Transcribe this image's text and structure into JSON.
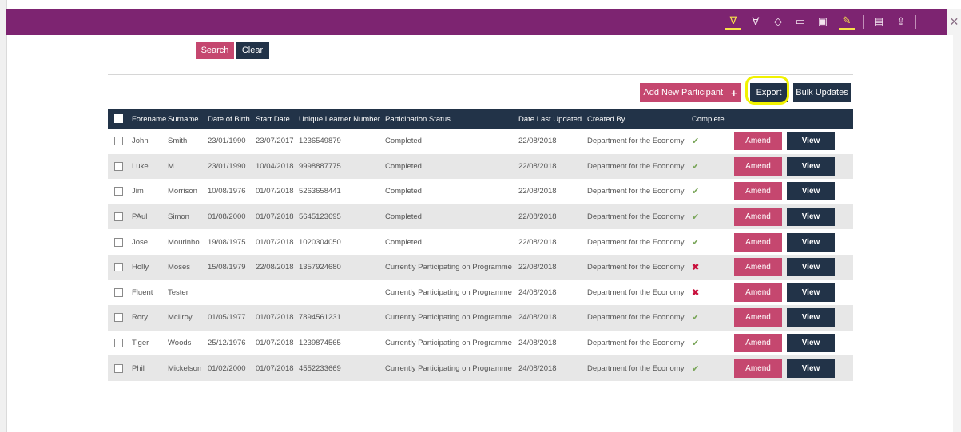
{
  "toolbar": {
    "tools": [
      {
        "icon": "pen-icon",
        "glyph": "∇"
      },
      {
        "icon": "highlighter-icon",
        "glyph": "∀"
      },
      {
        "icon": "eraser-icon",
        "glyph": "◇"
      },
      {
        "icon": "comment-icon",
        "glyph": "▭"
      },
      {
        "icon": "clip-icon",
        "glyph": "▣"
      },
      {
        "icon": "touch-write-icon",
        "glyph": "✎"
      },
      {
        "icon": "save-icon",
        "glyph": "▤"
      },
      {
        "icon": "share-icon",
        "glyph": "⇪"
      }
    ],
    "close_glyph": "✕"
  },
  "search": {
    "search_label": "Search",
    "clear_label": "Clear"
  },
  "actions": {
    "add_label": "Add New Participant",
    "add_glyph": "+",
    "export_label": "Export",
    "bulk_label": "Bulk Updates"
  },
  "table": {
    "headers": [
      "Forename",
      "Surname",
      "Date of Birth",
      "Start Date",
      "Unique Learner Number",
      "Participation Status",
      "Date Last Updated",
      "Created By",
      "Complete"
    ],
    "amend_label": "Amend",
    "view_label": "View",
    "rows": [
      {
        "forename": "John",
        "surname": "Smith",
        "dob": "23/01/1990",
        "start": "23/07/2017",
        "uln": "1236549879",
        "status": "Completed",
        "updated": "22/08/2018",
        "created_by": "Department for the Economy",
        "complete": "✔",
        "complete_state": "yes"
      },
      {
        "forename": "Luke",
        "surname": "M",
        "dob": "23/01/1990",
        "start": "10/04/2018",
        "uln": "9998887775",
        "status": "Completed",
        "updated": "22/08/2018",
        "created_by": "Department for the Economy",
        "complete": "✔",
        "complete_state": "yes"
      },
      {
        "forename": "Jim",
        "surname": "Morrison",
        "dob": "10/08/1976",
        "start": "01/07/2018",
        "uln": "5263658441",
        "status": "Completed",
        "updated": "22/08/2018",
        "created_by": "Department for the Economy",
        "complete": "✔",
        "complete_state": "yes"
      },
      {
        "forename": "PAul",
        "surname": "Simon",
        "dob": "01/08/2000",
        "start": "01/07/2018",
        "uln": "5645123695",
        "status": "Completed",
        "updated": "22/08/2018",
        "created_by": "Department for the Economy",
        "complete": "✔",
        "complete_state": "yes"
      },
      {
        "forename": "Jose",
        "surname": "Mourinho",
        "dob": "19/08/1975",
        "start": "01/07/2018",
        "uln": "1020304050",
        "status": "Completed",
        "updated": "22/08/2018",
        "created_by": "Department for the Economy",
        "complete": "✔",
        "complete_state": "yes"
      },
      {
        "forename": "Holly",
        "surname": "Moses",
        "dob": "15/08/1979",
        "start": "22/08/2018",
        "uln": "1357924680",
        "status": "Currently Participating on Programme",
        "updated": "22/08/2018",
        "created_by": "Department for the Economy",
        "complete": "✖",
        "complete_state": "no"
      },
      {
        "forename": "Fluent",
        "surname": "Tester",
        "dob": "",
        "start": "",
        "uln": "",
        "status": "Currently Participating on Programme",
        "updated": "24/08/2018",
        "created_by": "Department for the Economy",
        "complete": "✖",
        "complete_state": "no"
      },
      {
        "forename": "Rory",
        "surname": "McIlroy",
        "dob": "01/05/1977",
        "start": "01/07/2018",
        "uln": "7894561231",
        "status": "Currently Participating on Programme",
        "updated": "24/08/2018",
        "created_by": "Department for the Economy",
        "complete": "✔",
        "complete_state": "yes"
      },
      {
        "forename": "Tiger",
        "surname": "Woods",
        "dob": "25/12/1976",
        "start": "01/07/2018",
        "uln": "1239874565",
        "status": "Currently Participating on Programme",
        "updated": "24/08/2018",
        "created_by": "Department for the Economy",
        "complete": "✔",
        "complete_state": "yes"
      },
      {
        "forename": "Phil",
        "surname": "Mickelson",
        "dob": "01/02/2000",
        "start": "01/07/2018",
        "uln": "4552233669",
        "status": "Currently Participating on Programme",
        "updated": "24/08/2018",
        "created_by": "Department for the Economy",
        "complete": "✔",
        "complete_state": "yes"
      }
    ]
  }
}
